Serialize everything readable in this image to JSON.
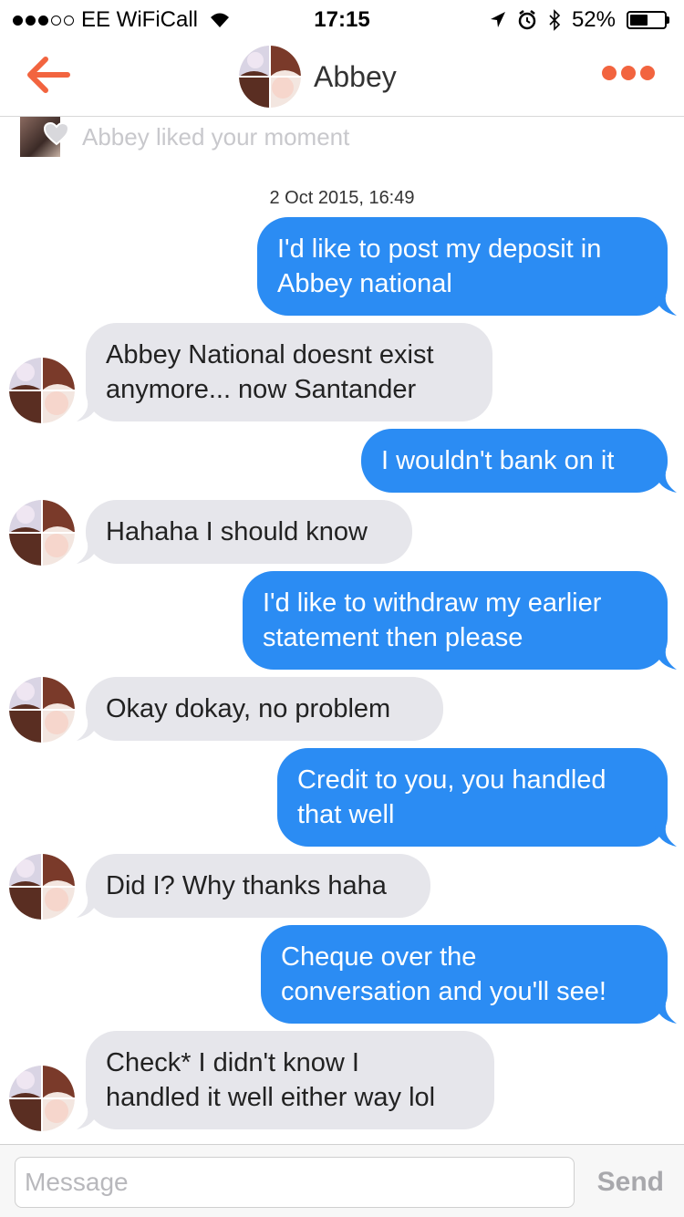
{
  "status_bar": {
    "carrier": "EE WiFiCall",
    "time": "17:15",
    "battery": "52%",
    "battery_level": 0.52,
    "signal_full_dots": 3,
    "signal_total_dots": 5
  },
  "header": {
    "contact_name": "Abbey",
    "accent_color": "#f2643f"
  },
  "moment": {
    "text": "Abbey liked your moment"
  },
  "timestamp": "2 Oct 2015, 16:49",
  "messages": [
    {
      "from": "me",
      "lines": [
        "I'd like to post my deposit in",
        "Abbey national"
      ]
    },
    {
      "from": "them",
      "lines": [
        "Abbey National doesnt exist",
        "anymore... now Santander"
      ]
    },
    {
      "from": "me",
      "lines": [
        "I wouldn't bank on it"
      ]
    },
    {
      "from": "them",
      "lines": [
        "Hahaha I should know"
      ]
    },
    {
      "from": "me",
      "lines": [
        "I'd like to withdraw my earlier",
        "statement then please"
      ]
    },
    {
      "from": "them",
      "lines": [
        "Okay dokay, no problem"
      ]
    },
    {
      "from": "me",
      "lines": [
        "Credit to you, you handled",
        "that well"
      ]
    },
    {
      "from": "them",
      "lines": [
        "Did I? Why thanks haha"
      ]
    },
    {
      "from": "me",
      "lines": [
        "Cheque over the",
        "conversation and you'll see!"
      ]
    },
    {
      "from": "them",
      "lines": [
        "Check* I didn't know I",
        "handled it well either way lol"
      ]
    }
  ],
  "input": {
    "placeholder": "Message",
    "send_label": "Send"
  },
  "colors": {
    "sent_bubble": "#2b8cf3",
    "received_bubble": "#e6e6eb"
  }
}
